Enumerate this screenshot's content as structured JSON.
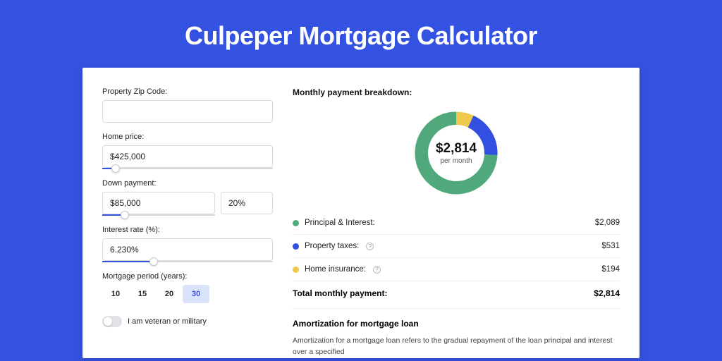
{
  "title": "Culpeper Mortgage Calculator",
  "colors": {
    "bg": "#3452e1",
    "principal": "#4fa97a",
    "taxes": "#314fe0",
    "insurance": "#efc94c"
  },
  "form": {
    "zip_label": "Property Zip Code:",
    "zip_value": "",
    "home_price_label": "Home price:",
    "home_price_value": "$425,000",
    "home_price_slider_pct": 8,
    "down_payment_label": "Down payment:",
    "down_payment_value": "$85,000",
    "down_payment_pct_value": "20%",
    "down_payment_slider_pct": 20,
    "interest_label": "Interest rate (%):",
    "interest_value": "6.230%",
    "interest_slider_pct": 30,
    "period_label": "Mortgage period (years):",
    "periods": [
      "10",
      "15",
      "20",
      "30"
    ],
    "period_active_index": 3,
    "veteran_label": "I am veteran or military",
    "veteran_on": false
  },
  "breakdown": {
    "title": "Monthly payment breakdown:",
    "center_amount": "$2,814",
    "center_sub": "per month",
    "items": [
      {
        "label": "Principal & Interest:",
        "value": "$2,089",
        "color": "#4fa97a",
        "info": false,
        "pct": 74.2
      },
      {
        "label": "Property taxes:",
        "value": "$531",
        "color": "#314fe0",
        "info": true,
        "pct": 18.9
      },
      {
        "label": "Home insurance:",
        "value": "$194",
        "color": "#efc94c",
        "info": true,
        "pct": 6.9
      }
    ],
    "total_label": "Total monthly payment:",
    "total_value": "$2,814"
  },
  "amortization": {
    "title": "Amortization for mortgage loan",
    "text": "Amortization for a mortgage loan refers to the gradual repayment of the loan principal and interest over a specified"
  },
  "chart_data": {
    "type": "pie",
    "title": "Monthly payment breakdown",
    "series": [
      {
        "name": "Principal & Interest",
        "value": 2089,
        "color": "#4fa97a"
      },
      {
        "name": "Property taxes",
        "value": 531,
        "color": "#314fe0"
      },
      {
        "name": "Home insurance",
        "value": 194,
        "color": "#efc94c"
      }
    ],
    "total": 2814,
    "unit": "USD per month"
  }
}
